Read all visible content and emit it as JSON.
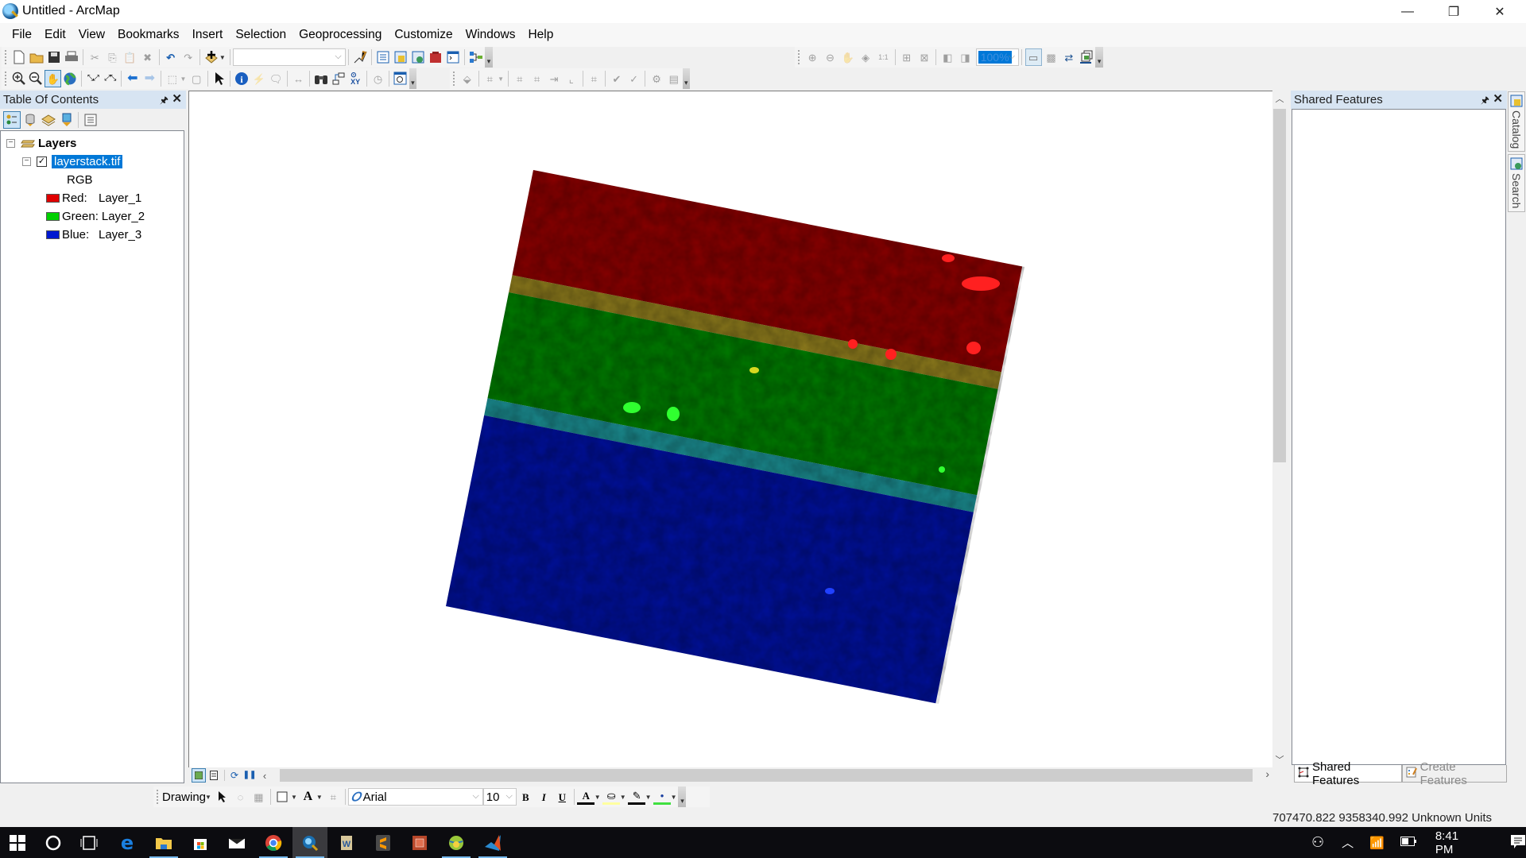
{
  "window": {
    "title": "Untitled - ArcMap",
    "controls": {
      "minimize": "—",
      "restore": "❐",
      "close": "✕"
    }
  },
  "menu": [
    "File",
    "Edit",
    "View",
    "Bookmarks",
    "Insert",
    "Selection",
    "Geoprocessing",
    "Customize",
    "Windows",
    "Help"
  ],
  "toolbar_standard": {
    "buttons": [
      "new-document",
      "open",
      "save",
      "print",
      "cut",
      "copy",
      "paste",
      "delete",
      "undo",
      "redo",
      "add-data"
    ],
    "scale_combo_value": "",
    "buttons_right": [
      "editor-toolbar",
      "table-of-contents",
      "catalog-window",
      "search-window",
      "arctoolbox",
      "python-window",
      "model-builder"
    ]
  },
  "toolbar_tools": {
    "buttons": [
      "zoom-in",
      "zoom-out",
      "pan",
      "full-extent",
      "fixed-zoom-in",
      "fixed-zoom-out",
      "go-back",
      "go-forward",
      "select-features",
      "clear-selection",
      "select-elements",
      "identify",
      "hyperlink",
      "html-popup",
      "measure",
      "find",
      "find-route",
      "go-to-xy",
      "time-slider",
      "create-viewer-window"
    ],
    "active": "pan"
  },
  "toolbar_layout": {
    "zoom_value": "100%",
    "buttons": [
      "zoom-in-layout",
      "zoom-out-layout",
      "pan-layout",
      "zoom-whole-page",
      "zoom-100-percent",
      "fixed-zoom-in-layout",
      "fixed-zoom-out-layout",
      "go-back-extent",
      "go-forward-extent",
      "toggle-draft-mode",
      "focus-data-frame",
      "change-layout",
      "data-driven-pages"
    ]
  },
  "toolbar_georef": {
    "buttons": [
      "edit-tool",
      "topology",
      "construct-features",
      "merge",
      "split",
      "align",
      "reshape",
      "validate",
      "share-edit",
      "error-inspector"
    ]
  },
  "toc": {
    "title": "Table Of Contents",
    "pin_icon": "📌",
    "close": "✕",
    "tools": [
      "list-by-drawing-order",
      "list-by-source",
      "list-by-visibility",
      "list-by-selection",
      "options"
    ],
    "root_label": "Layers",
    "layer": {
      "name": "layerstack.tif",
      "checked": true,
      "renderer": "RGB",
      "bands": [
        {
          "channel": "Red:",
          "band": "Layer_1",
          "color": "#e00000"
        },
        {
          "channel": "Green:",
          "band": "Layer_2",
          "color": "#00d000"
        },
        {
          "channel": "Blue:",
          "band": "Layer_3",
          "color": "#0018d0"
        }
      ]
    }
  },
  "map": {
    "raster_colors": {
      "red_band": "#8a0000",
      "yellow_overlap": "#8c7a1c",
      "green_band": "#007a00",
      "cyan_overlap": "#1a8a8e",
      "blue_band": "#00109a"
    },
    "view_buttons": [
      "data-view",
      "layout-view",
      "refresh",
      "pause-drawing"
    ]
  },
  "right_panel": {
    "title": "Shared Features",
    "tabs": [
      {
        "label": "Shared Features",
        "active": true
      },
      {
        "label": "Create Features",
        "active": false
      }
    ],
    "side_tabs": [
      "Catalog",
      "Search"
    ]
  },
  "drawing_toolbar": {
    "label": "Drawing",
    "font": "Arial",
    "font_size": "10",
    "bold": "B",
    "italic": "I",
    "underline": "U"
  },
  "status": {
    "coordinates": "707470.822  9358340.992 Unknown Units"
  },
  "taskbar": {
    "apps": [
      "start",
      "cortana",
      "task-view",
      "edge",
      "file-explorer",
      "store",
      "mail",
      "chrome",
      "arcmap",
      "word",
      "sublime",
      "powerpoint",
      "google-earth",
      "matlab"
    ],
    "active_app": "arcmap",
    "time": "8:41 PM"
  }
}
